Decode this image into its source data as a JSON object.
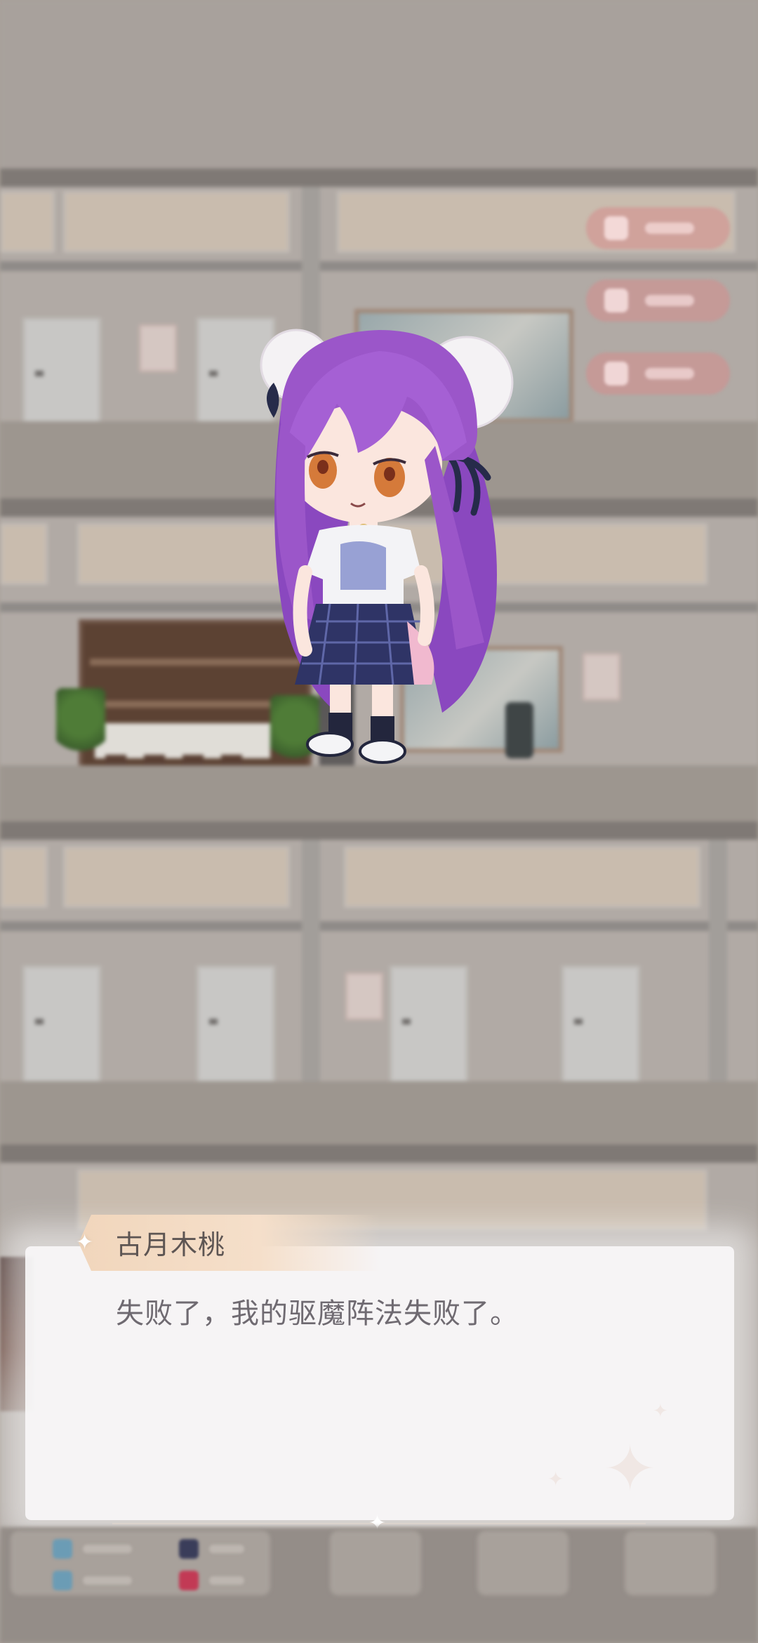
{
  "dialogue": {
    "speaker": "古月木桃",
    "text": "失败了，我的驱魔阵法失败了。"
  },
  "colors": {
    "nameplate": "#f1d6bc",
    "dialog_bg": "#f8f7f8",
    "speaker_text": "#5d5553",
    "dialog_text": "#6f6a71",
    "side_button": "#d68c8c",
    "hair": "#9b56c9"
  },
  "icons": {
    "name_sparkle": "sparkle-icon",
    "divider_sparkle": "sparkle-icon"
  }
}
